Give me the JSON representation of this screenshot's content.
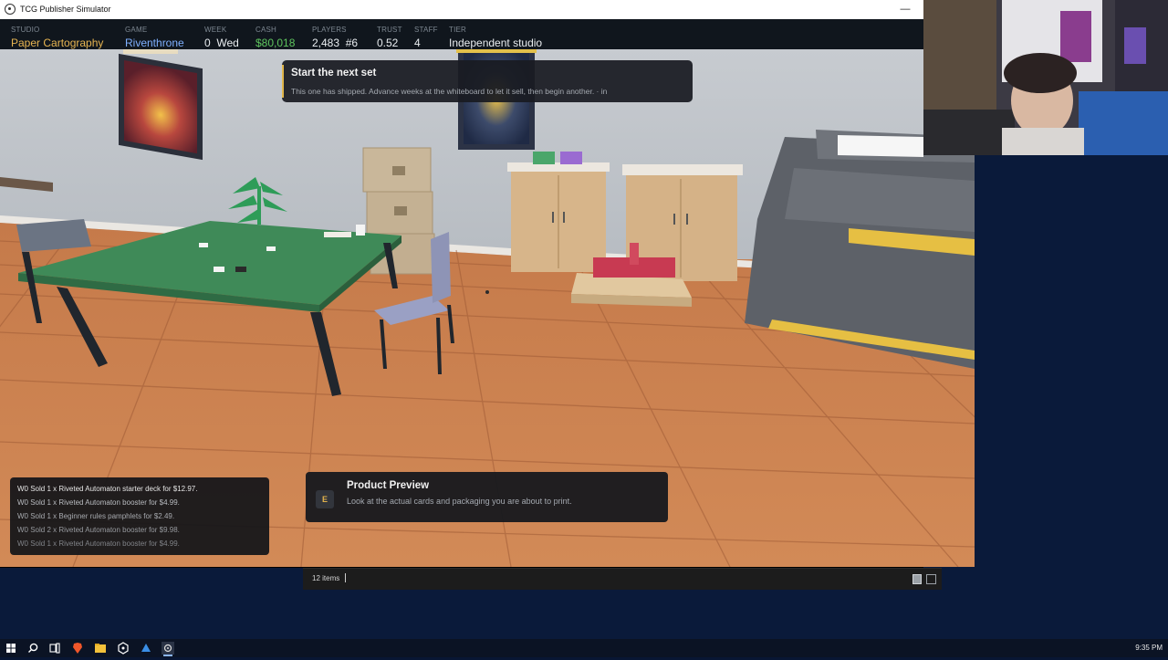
{
  "window": {
    "title": "TCG Publisher Simulator",
    "minimize_glyph": "—"
  },
  "hud": {
    "studio": {
      "label": "STUDIO",
      "value": "Paper Cartography",
      "color": "#e6b451"
    },
    "game": {
      "label": "GAME",
      "value": "Riventhrone",
      "color": "#7fb0ff"
    },
    "week": {
      "label": "WEEK",
      "value": "0  Wed"
    },
    "cash": {
      "label": "CASH",
      "value": "$80,018",
      "color": "#5ec45e"
    },
    "players": {
      "label": "PLAYERS",
      "value": "2,483  #6"
    },
    "trust": {
      "label": "TRUST",
      "value": "0.52"
    },
    "staff": {
      "label": "STAFF",
      "value": "4"
    },
    "tier": {
      "label": "TIER",
      "value": "Independent studio"
    }
  },
  "objective": {
    "title": "Start the next set",
    "description": "This one has shipped. Advance weeks at the whiteboard to let it sell, then begin another.   ·   in",
    "accent": "#e0b64a"
  },
  "log": {
    "entries": [
      "W0  Sold 1 x Riveted Automaton starter deck for $12.97.",
      "W0  Sold 1 x Riveted Automaton booster for $4.99.",
      "W0  Sold 1 x Beginner rules pamphlets for $2.49.",
      "W0  Sold 2 x Riveted Automaton booster for $9.98.",
      "W0  Sold 1 x Riveted Automaton booster for $4.99."
    ]
  },
  "prompt": {
    "key": "E",
    "title": "Product Preview",
    "description": "Look at the actual cards and packaging you are about to print."
  },
  "explorer": {
    "item_count": "12 items"
  },
  "taskbar": {
    "icons": [
      "windows-start-icon",
      "search-icon",
      "task-view-icon",
      "brave-browser-icon",
      "file-explorer-icon",
      "unity-icon",
      "app-blue-icon",
      "tcg-game-icon"
    ],
    "clock": "9:35 PM"
  }
}
